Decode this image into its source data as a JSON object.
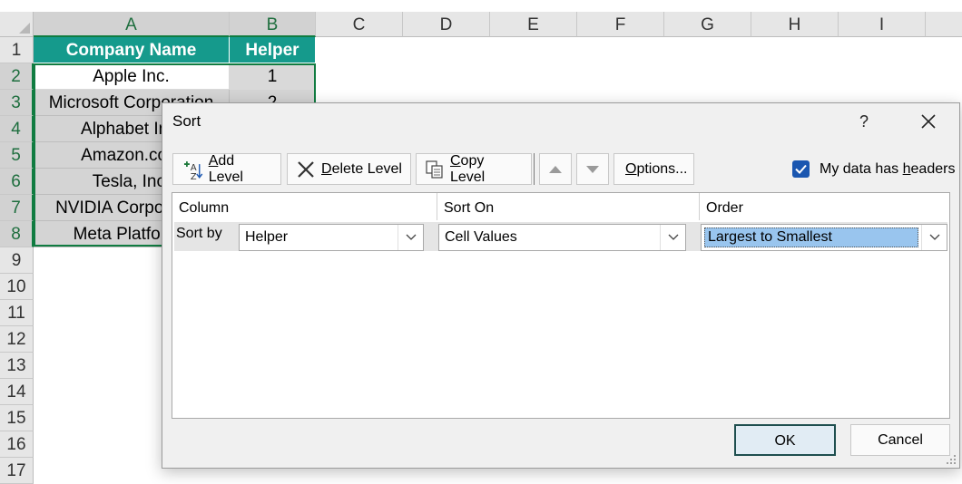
{
  "spreadsheet": {
    "columns": [
      "A",
      "B",
      "C",
      "D",
      "E",
      "F",
      "G",
      "H",
      "I"
    ],
    "rows": [
      "1",
      "2",
      "3",
      "4",
      "5",
      "6",
      "7",
      "8",
      "9",
      "10",
      "11",
      "12",
      "13",
      "14",
      "15",
      "16",
      "17"
    ],
    "header_row": {
      "a": "Company Name",
      "b": "Helper"
    },
    "data_rows": [
      {
        "a": "Apple Inc.",
        "b": "1"
      },
      {
        "a": "Microsoft Corporation",
        "b": "2"
      },
      {
        "a": "Alphabet Inc.",
        "b": ""
      },
      {
        "a": "Amazon.com",
        "b": ""
      },
      {
        "a": "Tesla, Inc.",
        "b": ""
      },
      {
        "a": "NVIDIA Corporation",
        "b": ""
      },
      {
        "a": "Meta Platforms",
        "b": ""
      }
    ],
    "colors": {
      "header_fill": "#159a8c",
      "selection_border": "#107c41"
    }
  },
  "dialog": {
    "title": "Sort",
    "help_label": "?",
    "toolbar": {
      "add_level": {
        "mnemonic": "A",
        "rest": "dd Level"
      },
      "delete_level": {
        "mnemonic": "D",
        "rest": "elete Level"
      },
      "copy_level": {
        "mnemonic": "C",
        "rest": "opy Level"
      },
      "options": {
        "mnemonic": "O",
        "rest": "ptions..."
      }
    },
    "headers_checkbox": {
      "checked": true,
      "label_prefix": "My data has ",
      "mnemonic": "h",
      "label_suffix": "eaders"
    },
    "grid": {
      "columns": [
        "Column",
        "Sort On",
        "Order"
      ],
      "row": {
        "label": "Sort by",
        "column_value": "Helper",
        "sort_on_value": "Cell Values",
        "order_value": "Largest to Smallest"
      }
    },
    "ok_label": "OK",
    "cancel_label": "Cancel",
    "icons": [
      "add-level-icon",
      "delete-level-icon",
      "copy-level-icon",
      "move-up-icon",
      "move-down-icon",
      "checkbox-checked-icon",
      "close-icon",
      "chevron-down-icon",
      "resize-grip-icon"
    ]
  }
}
